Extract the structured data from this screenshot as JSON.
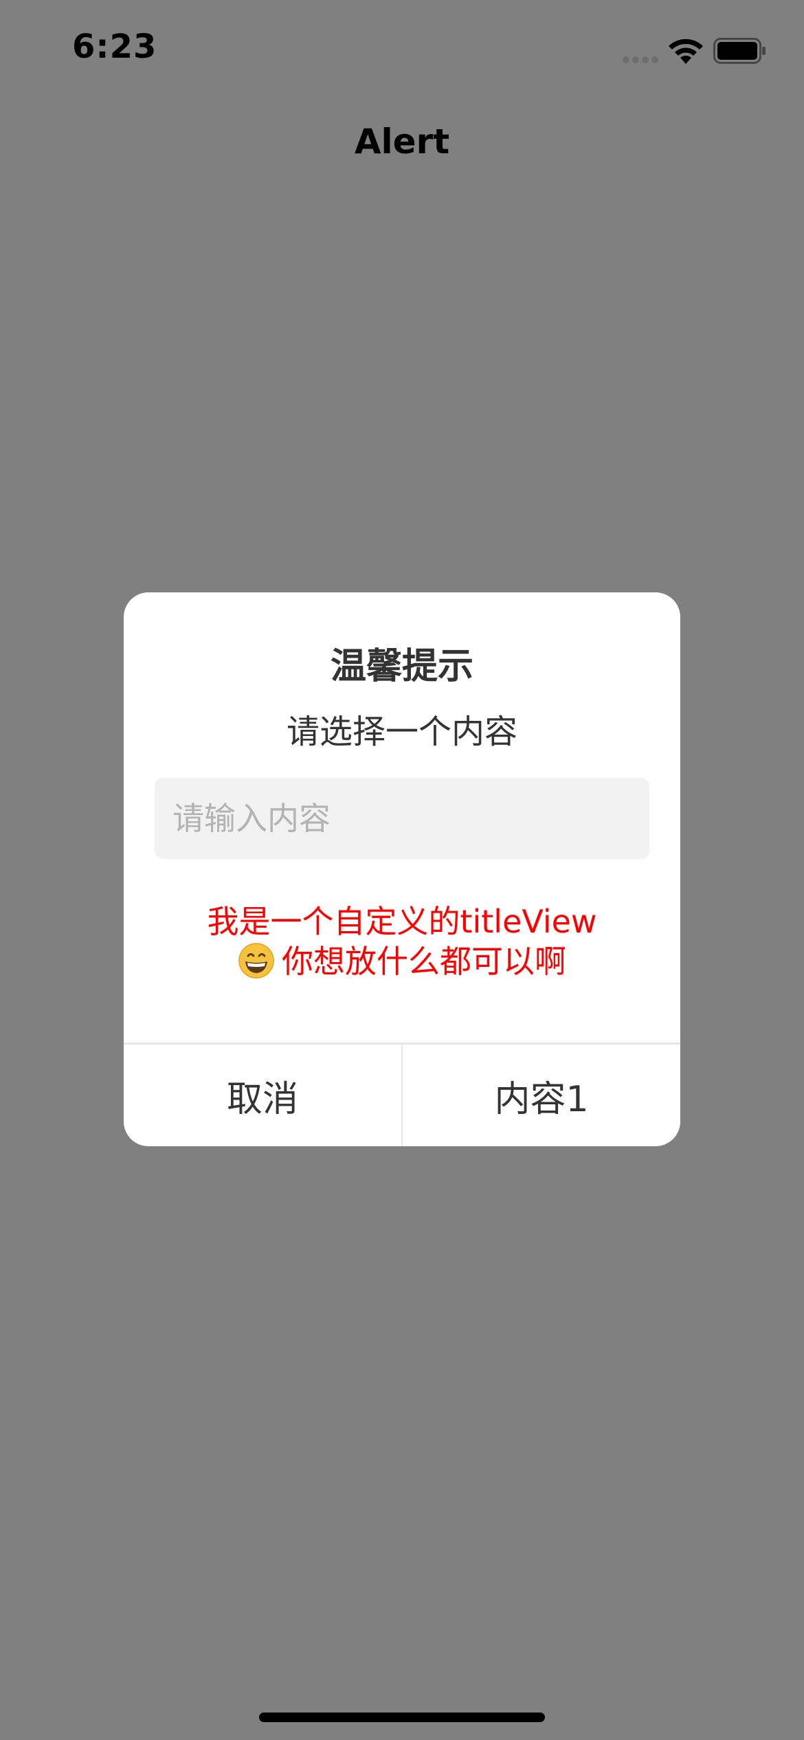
{
  "status_bar": {
    "time": "6:23",
    "icons": [
      "signal-icon",
      "wifi-icon",
      "battery-icon"
    ]
  },
  "nav": {
    "title": "Alert"
  },
  "alert": {
    "title": "温馨提示",
    "message": "请选择一个内容",
    "input": {
      "value": "",
      "placeholder": "请输入内容"
    },
    "custom_view": {
      "line1": "我是一个自定义的titleView",
      "emoji": "grinning-face-icon",
      "line2": "你想放什么都可以啊",
      "color": "#ff0000"
    },
    "buttons": {
      "cancel": "取消",
      "content1": "内容1"
    }
  },
  "colors": {
    "overlay": "#808080",
    "alert_bg": "#ffffff",
    "input_bg": "#f2f2f2",
    "text": "#333333",
    "accent_red": "#ff0000"
  }
}
